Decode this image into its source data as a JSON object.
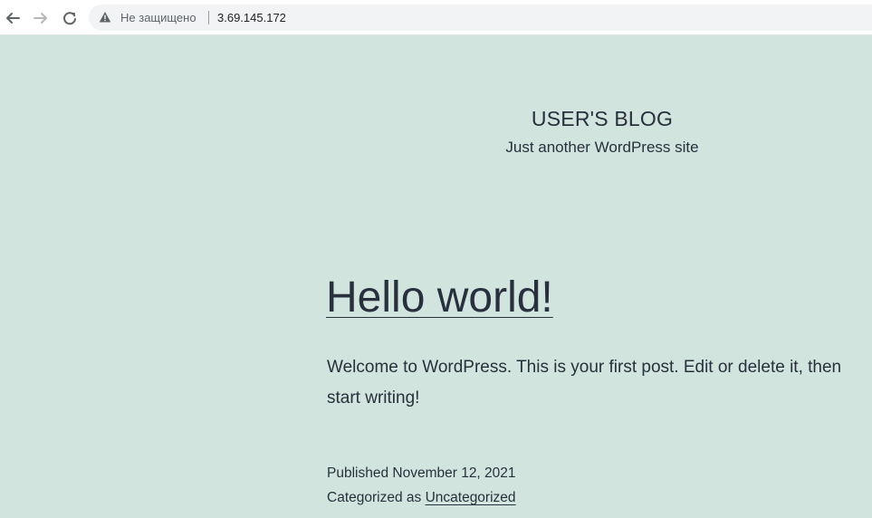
{
  "browser": {
    "security_label": "Не защищено",
    "url": "3.69.145.172"
  },
  "site": {
    "title": "USER'S BLOG",
    "tagline": "Just another WordPress site"
  },
  "post": {
    "title": "Hello world!",
    "body": "Welcome to WordPress. This is your first post. Edit or delete it, then start writing!",
    "published_label": "Published",
    "published_date": "November 12, 2021",
    "categorized_label": "Categorized as",
    "category": "Uncategorized"
  },
  "colors": {
    "background": "#d1e4dd",
    "text": "#28303d"
  }
}
